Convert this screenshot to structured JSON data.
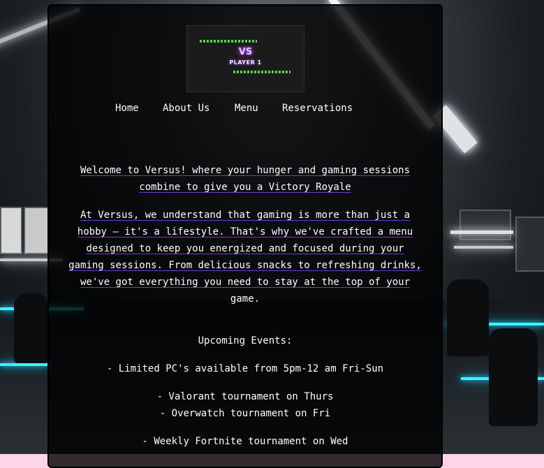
{
  "logo": {
    "vs": "VS",
    "player": "PLAYER 1"
  },
  "nav": {
    "home": "Home",
    "about": "About Us",
    "menu": "Menu",
    "reservations": "Reservations"
  },
  "content": {
    "welcome_line1": "Welcome to Versus! where your hunger and gaming sessions",
    "welcome_line2": "combine to give you a Victory Royale",
    "about_lines": [
      "At Versus, we understand that gaming is more than just a",
      "hobby – it's a lifestyle. That's why we've crafted a menu",
      "designed to keep you energized and focused during your",
      "gaming sessions. From delicious snacks to refreshing drinks,",
      "we've got everything you need to stay at the top of your",
      "game."
    ],
    "events_heading": "Upcoming Events:",
    "events": [
      "- Limited PC's available from 5pm-12 am Fri-Sun",
      "- Valorant tournament on Thurs",
      "- Overwatch tournament on Fri",
      "- Weekly Fortnite tournament on Wed"
    ]
  },
  "colors": {
    "panel": "#000000",
    "underline": "#7a35d8",
    "neon": "#3ff3ff",
    "logo_glow": "#b84dff",
    "logo_stripes": "#59d34a",
    "page_bottom": "#ffd6e8"
  }
}
